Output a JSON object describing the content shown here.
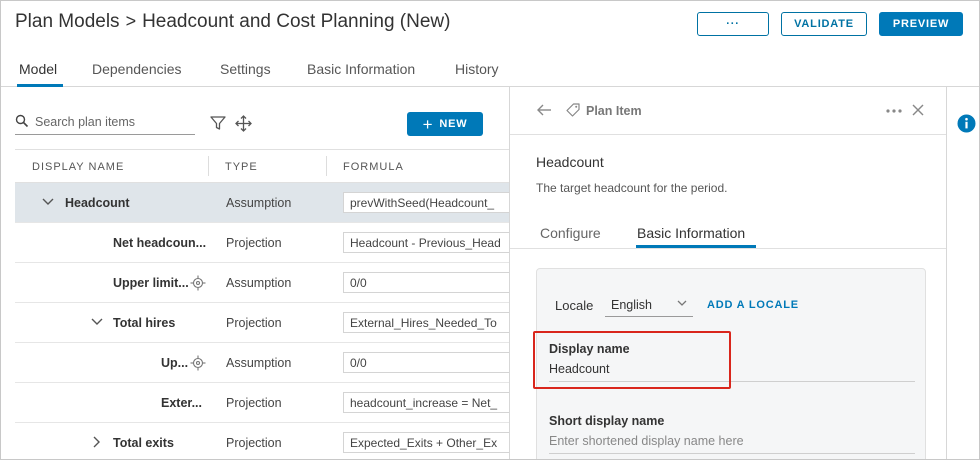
{
  "header": {
    "breadcrumb_root": "Plan Models",
    "breadcrumb_sep": ">",
    "title": "Headcount and Cost Planning (New)",
    "more_label": "···",
    "validate_label": "VALIDATE",
    "preview_label": "PREVIEW"
  },
  "tabs": [
    "Model",
    "Dependencies",
    "Settings",
    "Basic Information",
    "History"
  ],
  "toolbar": {
    "search_placeholder": "Search plan items",
    "new_label": "NEW"
  },
  "grid": {
    "columns": [
      "DISPLAY NAME",
      "TYPE",
      "FORMULA"
    ],
    "rows": [
      {
        "name": "Headcount",
        "type": "Assumption",
        "formula": "prevWithSeed(Headcount_"
      },
      {
        "name": "Net headcoun...",
        "type": "Projection",
        "formula": "Headcount - Previous_Head"
      },
      {
        "name": "Upper limit...",
        "type": "Assumption",
        "formula": "0/0"
      },
      {
        "name": "Total hires",
        "type": "Projection",
        "formula": "External_Hires_Needed_To"
      },
      {
        "name": "Up...",
        "type": "Assumption",
        "formula": "0/0"
      },
      {
        "name": "Exter...",
        "type": "Projection",
        "formula": "headcount_increase = Net_"
      },
      {
        "name": "Total exits",
        "type": "Projection",
        "formula": "Expected_Exits + Other_Ex"
      }
    ]
  },
  "panel": {
    "title": "Plan Item",
    "item_name": "Headcount",
    "item_desc": "The target headcount for the period.",
    "tabs": [
      "Configure",
      "Basic Information"
    ],
    "locale_label": "Locale",
    "locale_value": "English",
    "add_locale": "ADD A LOCALE",
    "display_name_label": "Display name",
    "display_name_value": "Headcount",
    "short_name_label": "Short display name",
    "short_name_placeholder": "Enter shortened display name here"
  },
  "colors": {
    "accent": "#0079b8",
    "highlight": "#d9261c",
    "selected_row": "#dfe5ea"
  }
}
